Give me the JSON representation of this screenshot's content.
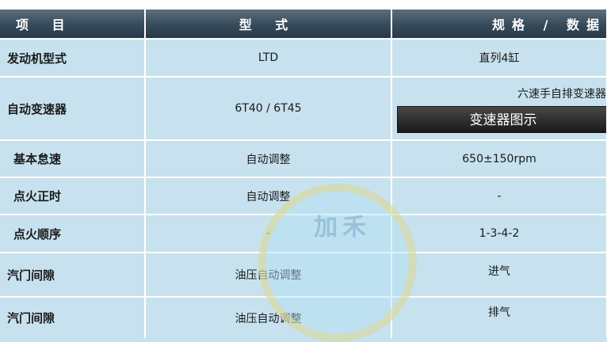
{
  "header": {
    "col1": "项 目",
    "col2": "型 式",
    "col3": "规格 / 数据"
  },
  "rows": [
    {
      "item": "发动机型式",
      "type": "LTD",
      "spec": "直列4缸"
    },
    {
      "item": "自动变速器",
      "type": "6T40 / 6T45",
      "spec": "六速手自排变速器",
      "button": "变速器图示"
    },
    {
      "item": "基本怠速",
      "type": "自动调整",
      "spec": "650±150rpm"
    },
    {
      "item": "点火正时",
      "type": "自动调整",
      "spec": "-"
    },
    {
      "item": "点火顺序",
      "type": "-",
      "spec": "1-3-4-2"
    },
    {
      "item": "汽门间隙",
      "type": "油压自动调整",
      "spec": "进气"
    },
    {
      "item": "汽门间隙",
      "type": "油压自动调整",
      "spec": "排气"
    }
  ],
  "watermark": {
    "text": "加禾"
  }
}
